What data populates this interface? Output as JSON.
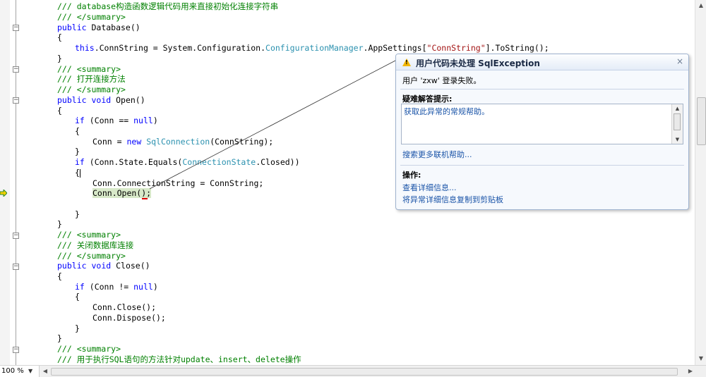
{
  "code": {
    "l1": [
      "/// ",
      "database构造函数逻辑代码用来直接初始化连接字符串"
    ],
    "l2": "/// </summary>",
    "l3": [
      "public",
      " Database()"
    ],
    "l4": "{",
    "l5": [
      "this",
      ".ConnString = System.Configuration.",
      "ConfigurationManager",
      ".AppSettings[",
      "\"ConnString\"",
      "].ToString();"
    ],
    "l6": "}",
    "l7": "/// <summary>",
    "l8": "/// 打开连接方法",
    "l9": "/// </summary>",
    "l10": [
      "public",
      " ",
      "void",
      " Open()"
    ],
    "l11": "{",
    "l12": [
      "if",
      " (Conn == ",
      "null",
      ")"
    ],
    "l13": "{",
    "l14": [
      "Conn = ",
      "new",
      " ",
      "SqlConnection",
      "(ConnString);"
    ],
    "l15": "}",
    "l16": [
      "if",
      " (Conn.State.Equals(",
      "ConnectionState",
      ".Closed))"
    ],
    "l17": "{",
    "l18": "Conn.ConnectionString = ConnString;",
    "l19": "Conn.Open();",
    "l21": "}",
    "l22": "}",
    "l23": "/// <summary>",
    "l24": "/// 关闭数据库连接",
    "l25": "/// </summary>",
    "l26": [
      "public",
      " ",
      "void",
      " Close()"
    ],
    "l27": "{",
    "l28": [
      "if",
      " (Conn != ",
      "null",
      ")"
    ],
    "l29": "{",
    "l30": "Conn.Close();",
    "l31": "Conn.Dispose();",
    "l32": "}",
    "l33": "}",
    "l34": "/// <summary>",
    "l35": "/// 用于执行SQL语句的方法针对update、insert、delete操作"
  },
  "fold_glyph": "−",
  "zoom": {
    "value": "100 %"
  },
  "exception": {
    "title": "用户代码未处理 SqlException",
    "close": "×",
    "message": "用户 'zxw' 登录失败。",
    "tips_heading": "疑难解答提示:",
    "tips_item": "获取此异常的常规帮助。",
    "search_link": "搜索更多联机帮助...",
    "actions_heading": "操作:",
    "action_view_detail": "查看详细信息...",
    "action_copy": "将异常详细信息复制到剪贴板"
  },
  "icons": {
    "warning": "warning-icon",
    "exec_arrow": "execution-arrow-icon",
    "fold": "collapse-icon"
  },
  "colors": {
    "comment": "#008000",
    "keyword": "#0000ff",
    "type": "#2b91af",
    "string": "#a31515",
    "current_line_highlight": "#d8e9c9"
  }
}
